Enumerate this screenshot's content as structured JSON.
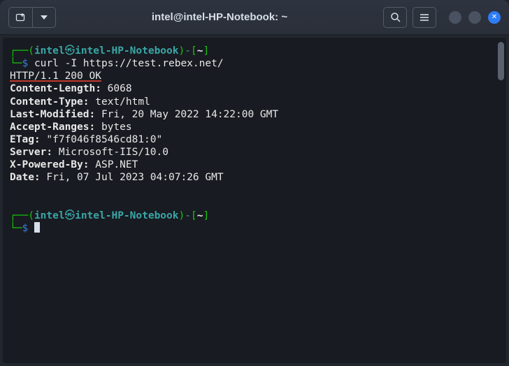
{
  "titlebar": {
    "title": "intel@intel-HP-Notebook: ~"
  },
  "prompt": {
    "l_paren": "(",
    "user": "intel",
    "at": "㉿",
    "host": "intel-HP-Notebook",
    "r_paren": ")",
    "dash": "-",
    "lbracket": "[",
    "cwd": "~",
    "rbracket": "]",
    "corner_top": "┌──",
    "corner_bot": "└─",
    "dollar": "$"
  },
  "cmd": {
    "command": "curl -I https://test.rebex.net/"
  },
  "response": {
    "status_line": "HTTP/1.1 200 OK",
    "content_length_k": "Content-Length:",
    "content_length_v": " 6068",
    "content_type_k": "Content-Type:",
    "content_type_v": " text/html",
    "last_modified_k": "Last-Modified:",
    "last_modified_v": " Fri, 20 May 2022 14:22:00 GMT",
    "accept_ranges_k": "Accept-Ranges:",
    "accept_ranges_v": " bytes",
    "etag_k": "ETag:",
    "etag_v": " \"f7f046f8546cd81:0\"",
    "server_k": "Server:",
    "server_v": " Microsoft-IIS/10.0",
    "x_powered_by_k": "X-Powered-By:",
    "x_powered_by_v": " ASP.NET",
    "date_k": "Date:",
    "date_v": " Fri, 07 Jul 2023 04:07:26 GMT"
  }
}
